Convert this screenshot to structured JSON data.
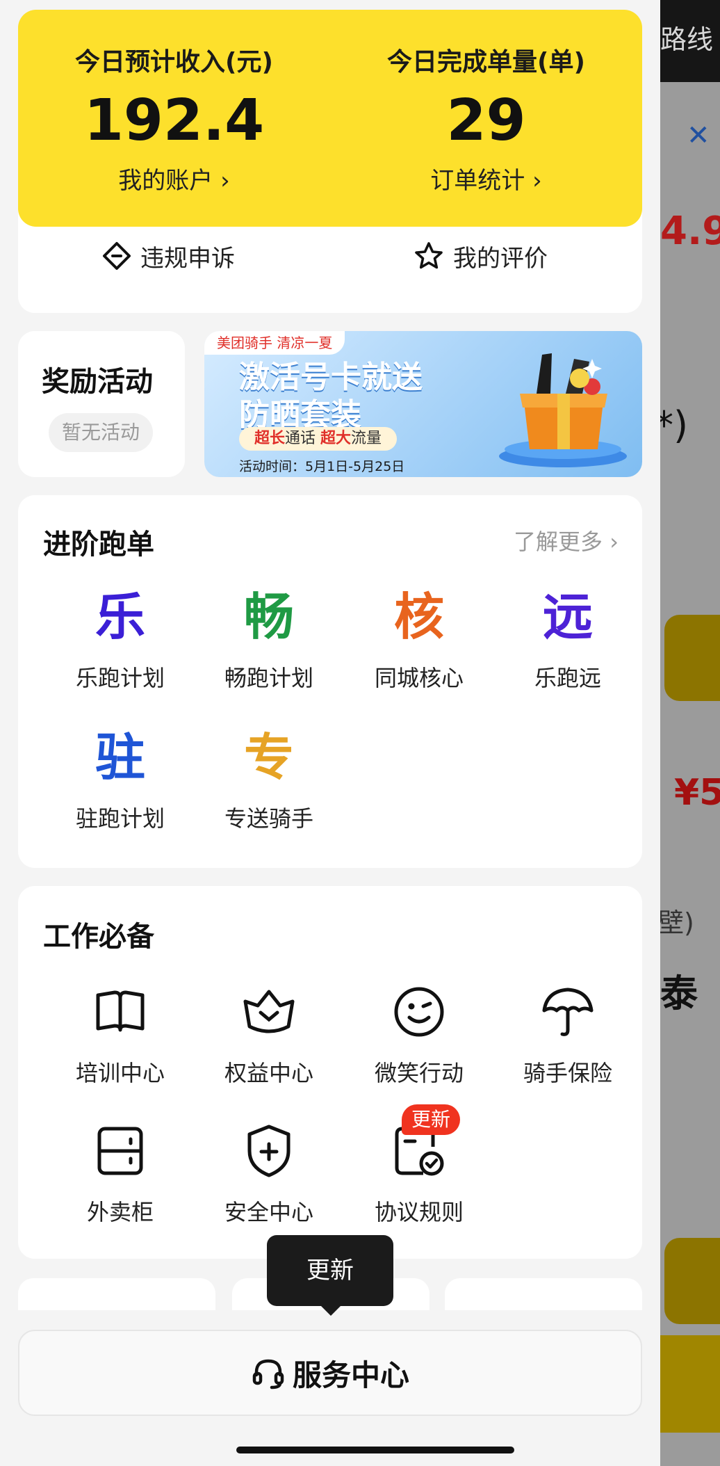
{
  "background": {
    "route_label": "路线",
    "rating": "4.9",
    "paren": "*)",
    "price": "¥5",
    "wall": "壁)",
    "name_char": "泰"
  },
  "earnings": {
    "income_label": "今日预计收入(元)",
    "income_value": "192.4",
    "account_link": "我的账户 ›",
    "orders_label": "今日完成单量(单)",
    "orders_value": "29",
    "stats_link": "订单统计 ›"
  },
  "quick_actions": {
    "appeal": "违规申诉",
    "reviews": "我的评价"
  },
  "rewards": {
    "title": "奖励活动",
    "empty": "暂无活动"
  },
  "banner": {
    "tag": "美团骑手 清凉一夏",
    "headline": "激活号卡就送\n防晒套装",
    "sub_a": "超长",
    "sub_b": "通话",
    "sub_c": "超大",
    "sub_d": "流量",
    "time": "活动时间：5月1日-5月25日"
  },
  "advanced": {
    "title": "进阶跑单",
    "more": "了解更多 ›",
    "items": [
      {
        "glyph": "乐",
        "label": "乐跑计划",
        "color": "#3b1fd6"
      },
      {
        "glyph": "畅",
        "label": "畅跑计划",
        "color": "#1f9a44"
      },
      {
        "glyph": "核",
        "label": "同城核心",
        "color": "#e8641e"
      },
      {
        "glyph": "远",
        "label": "乐跑远",
        "color": "#4d22d6"
      },
      {
        "glyph": "驻",
        "label": "驻跑计划",
        "color": "#1f55d6"
      },
      {
        "glyph": "专",
        "label": "专送骑手",
        "color": "#e6a325"
      }
    ]
  },
  "work": {
    "title": "工作必备",
    "items": [
      {
        "label": "培训中心",
        "icon": "book-icon"
      },
      {
        "label": "权益中心",
        "icon": "crown-icon"
      },
      {
        "label": "微笑行动",
        "icon": "smile-icon"
      },
      {
        "label": "骑手保险",
        "icon": "umbrella-icon"
      },
      {
        "label": "外卖柜",
        "icon": "locker-icon"
      },
      {
        "label": "安全中心",
        "icon": "shield-icon"
      },
      {
        "label": "协议规则",
        "icon": "agreement-icon"
      }
    ],
    "badge": "更新"
  },
  "tooltip": "更新",
  "service_center": "服务中心"
}
